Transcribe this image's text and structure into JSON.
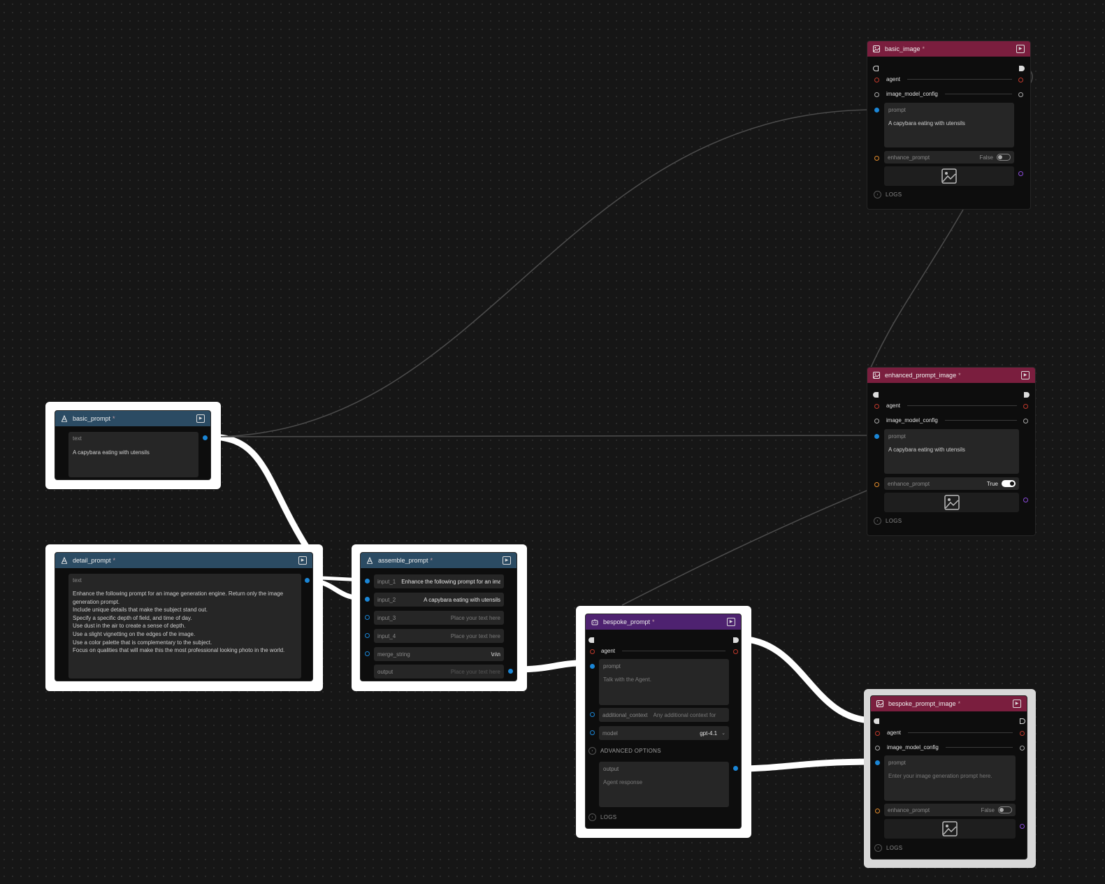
{
  "nodes": {
    "basic_image": {
      "title": "basic_image",
      "star": "*",
      "agent_label": "agent",
      "image_model_config_label": "image_model_config",
      "prompt_label": "prompt",
      "prompt_value": "A capybara eating with utensils",
      "enhance_label": "enhance_prompt",
      "enhance_value": "False",
      "logs": "LOGS"
    },
    "enhanced_prompt_image": {
      "title": "enhanced_prompt_image",
      "star": "*",
      "agent_label": "agent",
      "image_model_config_label": "image_model_config",
      "prompt_label": "prompt",
      "prompt_value": "A capybara eating with utensils",
      "enhance_label": "enhance_prompt",
      "enhance_value": "True",
      "logs": "LOGS"
    },
    "basic_prompt": {
      "title": "basic_prompt",
      "star": "*",
      "text_label": "text",
      "text_value": "A capybara eating with utensils"
    },
    "detail_prompt": {
      "title": "detail_prompt",
      "star": "*",
      "text_label": "text",
      "text_value": "Enhance the following prompt for an image generation engine. Return only the image generation prompt.\nInclude unique details that make the subject stand out.\nSpecify a specific depth of field, and time of day.\nUse dust in the air to create a sense of depth.\nUse a slight vignetting on the edges of the image.\nUse a color palette that is complementary to the subject.\nFocus on qualities that will make this the most professional looking photo in the world."
    },
    "assemble_prompt": {
      "title": "assemble_prompt",
      "star": "*",
      "input_1_label": "input_1",
      "input_1_value": "Enhance the following prompt for an image",
      "input_2_label": "input_2",
      "input_2_value": "A capybara eating with utensils",
      "input_3_label": "input_3",
      "input_3_placeholder": "Place your text here",
      "input_4_label": "input_4",
      "input_4_placeholder": "Place your text here",
      "merge_label": "merge_string",
      "merge_value": "\\n\\n",
      "output_label": "output",
      "output_placeholder": "Place your text here"
    },
    "bespoke_prompt": {
      "title": "bespoke_prompt",
      "star": "*",
      "agent_label": "agent",
      "prompt_label": "prompt",
      "prompt_placeholder": "Talk with the Agent.",
      "additional_context_label": "additional_context",
      "additional_context_placeholder": "Any additional context for",
      "model_label": "model",
      "model_value": "gpt-4.1",
      "advanced": "ADVANCED OPTIONS",
      "output_label": "output",
      "output_placeholder": "Agent response",
      "logs": "LOGS"
    },
    "bespoke_prompt_image": {
      "title": "bespoke_prompt_image",
      "star": "*",
      "agent_label": "agent",
      "image_model_config_label": "image_model_config",
      "prompt_label": "prompt",
      "prompt_placeholder": "Enter your image generation prompt here.",
      "enhance_label": "enhance_prompt",
      "enhance_value": "False",
      "logs": "LOGS"
    }
  },
  "colors": {
    "canvas": "#161616",
    "text_node_header": "#2b4b63",
    "image_node_header": "#7a1e3e",
    "agent_node_header": "#4e2270",
    "port_text": "#1b86d6",
    "port_agent": "#c0392b",
    "port_bool": "#e08a2c",
    "port_image": "#8a4bd8",
    "highlight": "#ffffff"
  },
  "icons": {
    "text_node": "text-a-icon",
    "image_node": "image-icon",
    "agent_node": "robot-icon",
    "run": "play-button-icon",
    "image_placeholder": "image-placeholder-icon",
    "logs": "chevron-right-icon",
    "dropdown": "chevron-down-icon"
  }
}
